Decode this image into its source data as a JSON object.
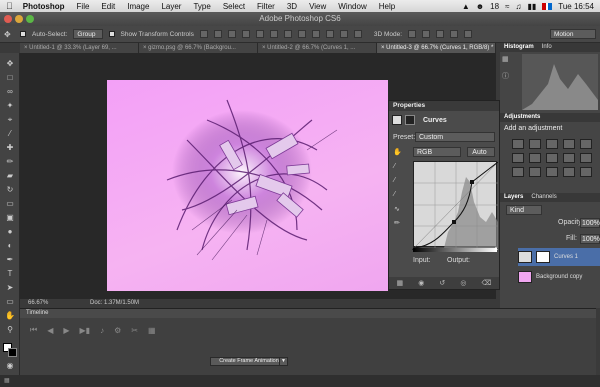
{
  "menubar": {
    "app": "Photoshop",
    "items": [
      "File",
      "Edit",
      "Image",
      "Layer",
      "Type",
      "Select",
      "Filter",
      "3D",
      "View",
      "Window",
      "Help"
    ],
    "battery": "18",
    "clock": "Tue 16:54"
  },
  "window_title": "Adobe Photoshop CS6",
  "options": {
    "auto_select_label": "Auto-Select:",
    "auto_select_value": "Group",
    "show_transform": "Show Transform Controls",
    "mode_label": "3D Mode:",
    "workspace": "Motion"
  },
  "tabs": [
    {
      "label": "Untitled-1 @ 33.3% (Layer 69, ...",
      "active": false
    },
    {
      "label": "gizmo.psg @ 66.7% (Backgrou...",
      "active": false
    },
    {
      "label": "Untitled-2 @ 66.7% (Curves 1, ...",
      "active": false
    },
    {
      "label": "Untitled-3 @ 66.7% (Curves 1, RGB/8) *",
      "active": true
    }
  ],
  "status": {
    "zoom": "66.67%",
    "doc": "Doc: 1.37M/1.50M"
  },
  "timeline": {
    "title": "Timeline",
    "create_button": "Create Frame Animation"
  },
  "properties": {
    "title": "Properties",
    "adjustment": "Curves",
    "preset_label": "Preset:",
    "preset_value": "Custom",
    "channel": "RGB",
    "auto": "Auto",
    "input": "Input:",
    "output": "Output:"
  },
  "right": {
    "histogram": "Histogram",
    "info": "Info",
    "adjustments": "Adjustments",
    "add_adjustment": "Add an adjustment",
    "layers": "Layers",
    "channels": "Channels",
    "kind": "Kind",
    "opacity_label": "Opacity:",
    "opacity": "100%",
    "fill_label": "Fill:",
    "fill": "100%",
    "layer_items": [
      {
        "name": "Curves 1"
      },
      {
        "name": "Background copy"
      }
    ]
  },
  "colors": {
    "canvas": "#f3a0f7",
    "accent": "#4a6ea8"
  }
}
